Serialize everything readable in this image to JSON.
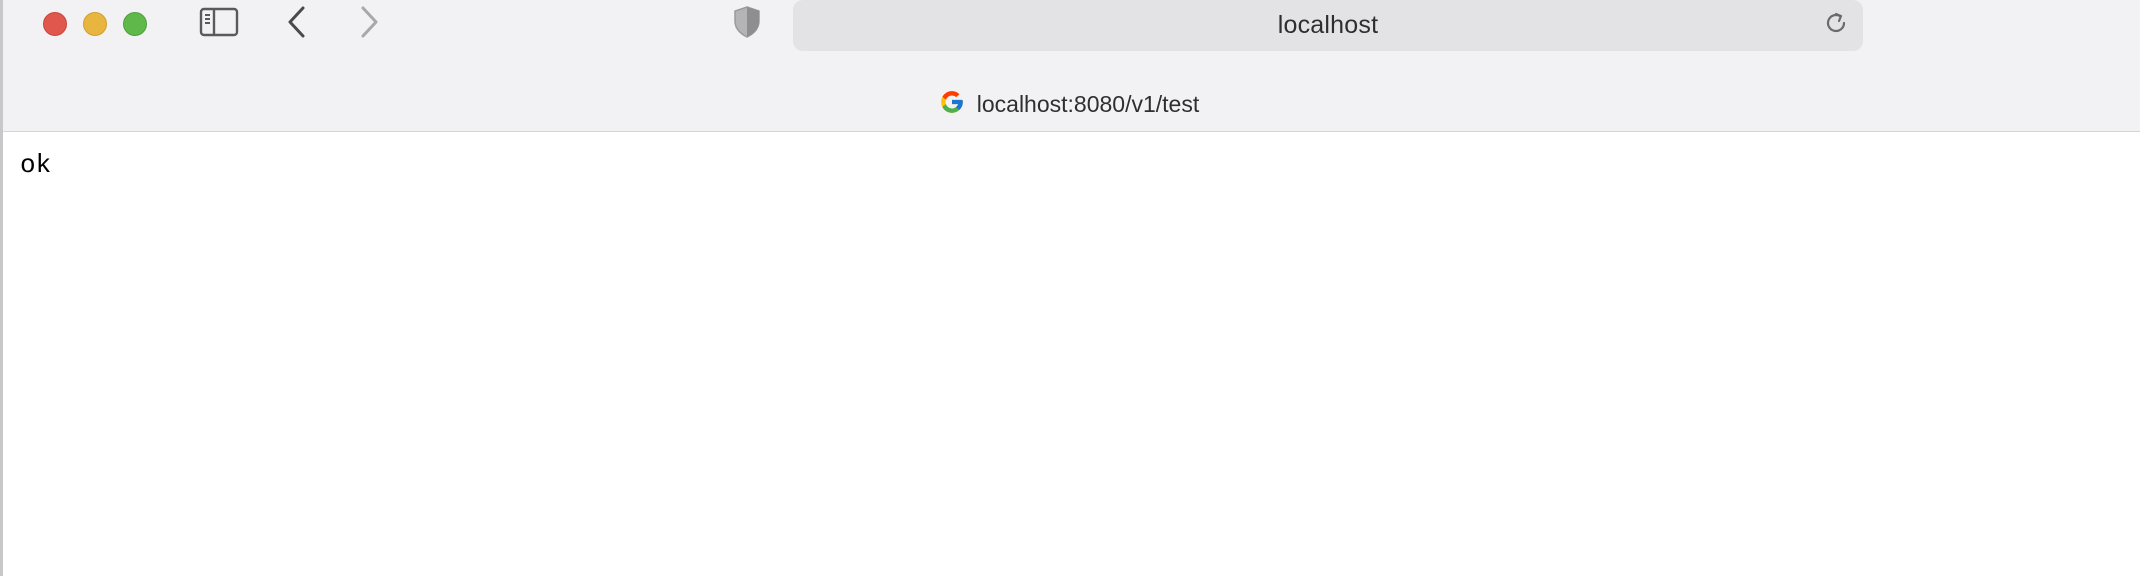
{
  "browser": {
    "address_bar": {
      "url_display": "localhost"
    },
    "tab": {
      "title": "localhost:8080/v1/test",
      "favicon": "google-g-icon"
    },
    "toolbar_icons": {
      "sidebar": "sidebar-icon",
      "back": "chevron-left-icon",
      "forward": "chevron-right-icon",
      "privacy": "shield-icon",
      "reload": "reload-icon"
    },
    "window_controls": {
      "close_color": "#e0574e",
      "minimize_color": "#e8b53f",
      "maximize_color": "#5fb94a"
    }
  },
  "page": {
    "body_text": "ok"
  }
}
